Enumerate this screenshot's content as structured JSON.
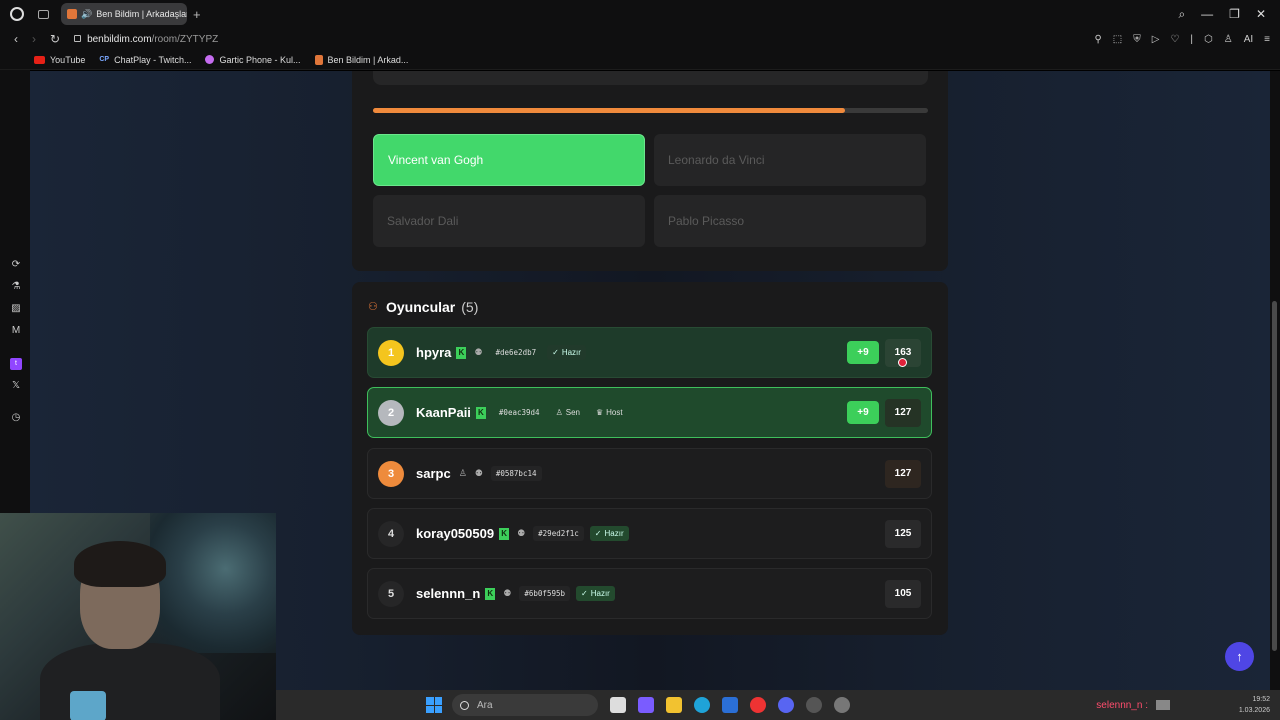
{
  "browser": {
    "tab_title": "Ben Bildim | Arkadaşlar",
    "tab_close": "×",
    "new_tab": "+",
    "url_host": "benbildim.com",
    "url_path": "/room/ZYTYPZ",
    "bookmarks": [
      {
        "label": "YouTube",
        "icon": "youtube-icon"
      },
      {
        "label": "ChatPlay - Twitch...",
        "icon": "chatplay-icon"
      },
      {
        "label": "Gartic Phone - Kul...",
        "icon": "gartic-icon"
      },
      {
        "label": "Ben Bildim | Arkad...",
        "icon": "benbildim-icon"
      }
    ],
    "ai_label": "AI"
  },
  "quiz": {
    "progress": 0.85,
    "options": [
      {
        "label": "Vincent van Gogh",
        "correct": true
      },
      {
        "label": "Leonardo da Vinci",
        "correct": false
      },
      {
        "label": "Salvador Dali",
        "correct": false
      },
      {
        "label": "Pablo Picasso",
        "correct": false
      }
    ]
  },
  "players": {
    "title": "Oyuncular",
    "count": "(5)",
    "list": [
      {
        "rank": "1",
        "name": "hpyra",
        "tag": "#de6e2db7",
        "badges": [
          "Hazır"
        ],
        "bonus": "+9",
        "score": "163"
      },
      {
        "rank": "2",
        "name": "KaanPaii",
        "tag": "#0eac39d4",
        "badges": [
          "Sen",
          "Host"
        ],
        "bonus": "+9",
        "score": "127"
      },
      {
        "rank": "3",
        "name": "sarpc",
        "tag": "#0587bc14",
        "badges": [],
        "bonus": "",
        "score": "127"
      },
      {
        "rank": "4",
        "name": "koray050509",
        "tag": "#29ed2f1c",
        "badges": [
          "Hazır"
        ],
        "bonus": "",
        "score": "125"
      },
      {
        "rank": "5",
        "name": "selennn_n",
        "tag": "#6b0f595b",
        "badges": [
          "Hazır"
        ],
        "bonus": "",
        "score": "105"
      }
    ]
  },
  "taskbar": {
    "search_placeholder": "Ara",
    "user_label": "selennn_n :",
    "clock_time": "19:52",
    "clock_date": "1.03.2026"
  },
  "colors": {
    "correct": "#42d86b",
    "progress": "#f08a3c",
    "accent_up": "#4f46e5"
  }
}
